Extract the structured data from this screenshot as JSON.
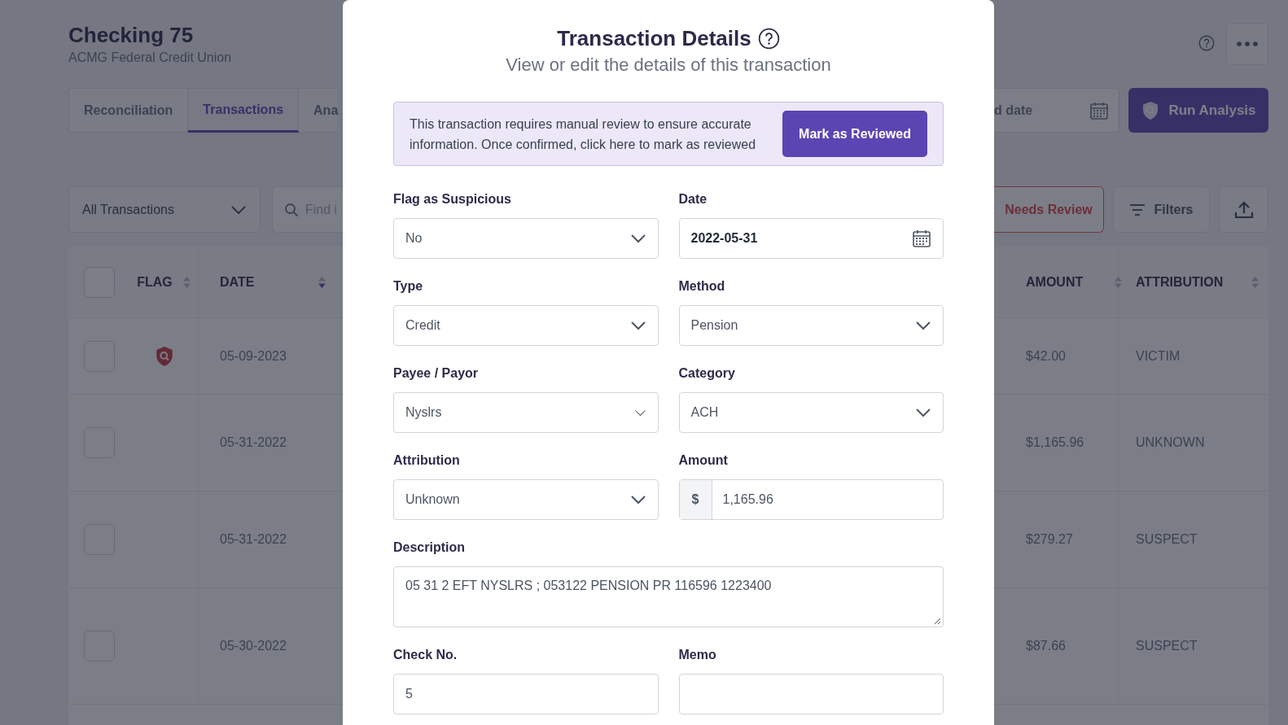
{
  "page": {
    "title": "Checking 75",
    "subtitle": "ACMG Federal Credit Union"
  },
  "tabs": [
    {
      "label": "Reconciliation",
      "selected": false
    },
    {
      "label": "Transactions",
      "selected": true
    },
    {
      "label": "Ana",
      "selected": false
    }
  ],
  "date_range": {
    "placeholder": "d date"
  },
  "run_button": "Run Analysis",
  "transaction_filter": {
    "value": "All Transactions"
  },
  "search": {
    "placeholder": "Find i"
  },
  "needs_review_button": "Needs Review",
  "filters_button": "Filters",
  "table": {
    "all_checked": false,
    "columns": [
      {
        "label": "FLAG",
        "sort_active": false
      },
      {
        "label": "DATE",
        "sort_active": true
      },
      {
        "label": "AMOUNT",
        "sort_active": false
      },
      {
        "label": "ATTRIBUTION",
        "sort_active": false
      }
    ],
    "rows": [
      {
        "checked": false,
        "flagged": true,
        "date": "05-09-2023",
        "amount": "$42.00",
        "attribution": "VICTIM"
      },
      {
        "checked": false,
        "flagged": false,
        "date": "05-31-2022",
        "amount": "$1,165.96",
        "attribution": "UNKNOWN"
      },
      {
        "checked": false,
        "flagged": false,
        "date": "05-31-2022",
        "amount": "$279.27",
        "attribution": "SUSPECT"
      },
      {
        "checked": false,
        "flagged": false,
        "date": "05-30-2022",
        "amount": "$87.66",
        "attribution": "SUSPECT"
      }
    ]
  },
  "modal": {
    "title": "Transaction Details",
    "subtitle": "View or edit the details of this transaction",
    "alert": "This transaction requires manual review to ensure accurate information. Once confirmed, click here to mark as reviewed",
    "alert_button": "Mark as Reviewed",
    "fields": [
      {
        "kind": "select",
        "label": "Flag as Suspicious",
        "value": "No"
      },
      {
        "kind": "date",
        "label": "Date",
        "value": "2022-05-31"
      },
      {
        "kind": "select",
        "label": "Type",
        "value": "Credit"
      },
      {
        "kind": "select",
        "label": "Method",
        "value": "Pension"
      },
      {
        "kind": "combobox",
        "label": "Payee / Payor",
        "value": "Nyslrs"
      },
      {
        "kind": "select",
        "label": "Category",
        "value": "ACH"
      },
      {
        "kind": "select",
        "label": "Attribution",
        "value": "Unknown"
      },
      {
        "kind": "currency",
        "label": "Amount",
        "prefix": "$",
        "value": "1,165.96"
      },
      {
        "kind": "textarea",
        "label": "Description",
        "value": "05 31 2 EFT NYSLRS ; 053122 PENSION PR 116596 1223400"
      },
      {
        "kind": "text",
        "label": "Check No.",
        "value": "5"
      },
      {
        "kind": "text",
        "label": "Memo"
      }
    ]
  }
}
